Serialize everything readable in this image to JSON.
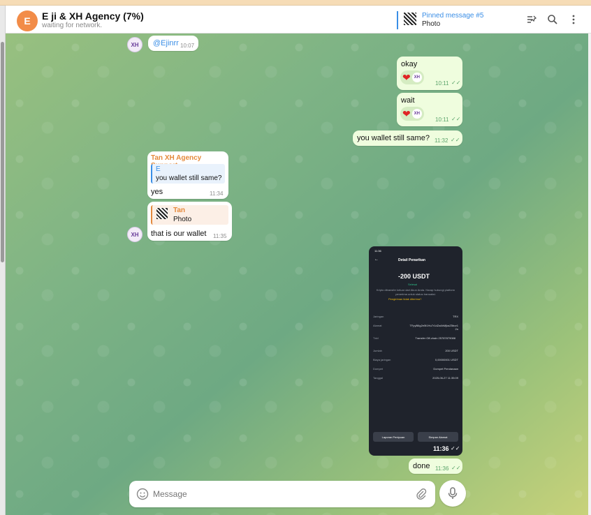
{
  "header": {
    "avatar_letter": "E",
    "title": "E ji & XH Agency (7%)",
    "subtitle": "waiting for network.",
    "pinned_title": "Pinned message #5",
    "pinned_preview": "Photo"
  },
  "messages": [
    {
      "id": "m1",
      "dir": "in",
      "text": "@Ejinrr",
      "time": "10:07"
    },
    {
      "id": "m2",
      "dir": "out",
      "text": "okay",
      "time": "10:11",
      "reaction": "❤"
    },
    {
      "id": "m3",
      "dir": "out",
      "text": "wait",
      "time": "10:11",
      "reaction": "❤"
    },
    {
      "id": "m4",
      "dir": "out",
      "text": "you wallet still same?",
      "time": "11:32"
    },
    {
      "id": "m5",
      "dir": "in",
      "sender": "Tan XH Agency Support",
      "reply_name": "E",
      "reply_text": "you wallet still same?",
      "text": "yes",
      "time": "11:34"
    },
    {
      "id": "m6",
      "dir": "in",
      "reply_name": "Tan",
      "reply_text": "Photo",
      "text": "that is our wallet",
      "time": "11:35"
    },
    {
      "id": "m7",
      "dir": "out",
      "kind": "photo",
      "time": "11:36"
    },
    {
      "id": "m8",
      "dir": "out",
      "text": "done",
      "time": "11:36"
    }
  ],
  "avatar_label": "XH",
  "screenshot": {
    "status_time": "11:36",
    "title": "Detail Penarikan",
    "amount": "-200 USDT",
    "status": "Selesai",
    "note": "Kripto ditransfer keluar dari Akun Anda. Harap hubungi platform penerima untuk status transaksi.",
    "help_link": "Pengiriman tidak diterima?",
    "rows": [
      {
        "label": "Jaringan",
        "value": "TRX"
      },
      {
        "label": "Alamat",
        "value": "TFpyB6g2e5t1Hu7r1dZa4bMjkaZ5bor12n"
      },
      {
        "label": "Txid",
        "value": "Transfer Off-chain 25787879088"
      },
      {
        "label": "Jumlah",
        "value": "200 USDT"
      },
      {
        "label": "Biaya jaringan",
        "value": "0,00000001 USDT"
      },
      {
        "label": "Dompet",
        "value": "Dompet Pendanaan"
      },
      {
        "label": "Tanggal",
        "value": "2025-06-27 11:35:09"
      }
    ],
    "btn_report": "Laporan Penipuan",
    "btn_save": "Simpan Alamat"
  },
  "composer": {
    "placeholder": "Message"
  },
  "colors": {
    "accent": "#3a8ee6",
    "avatar": "#f28c48",
    "out_bubble": "#effdde",
    "sender": "#e58a3c"
  }
}
